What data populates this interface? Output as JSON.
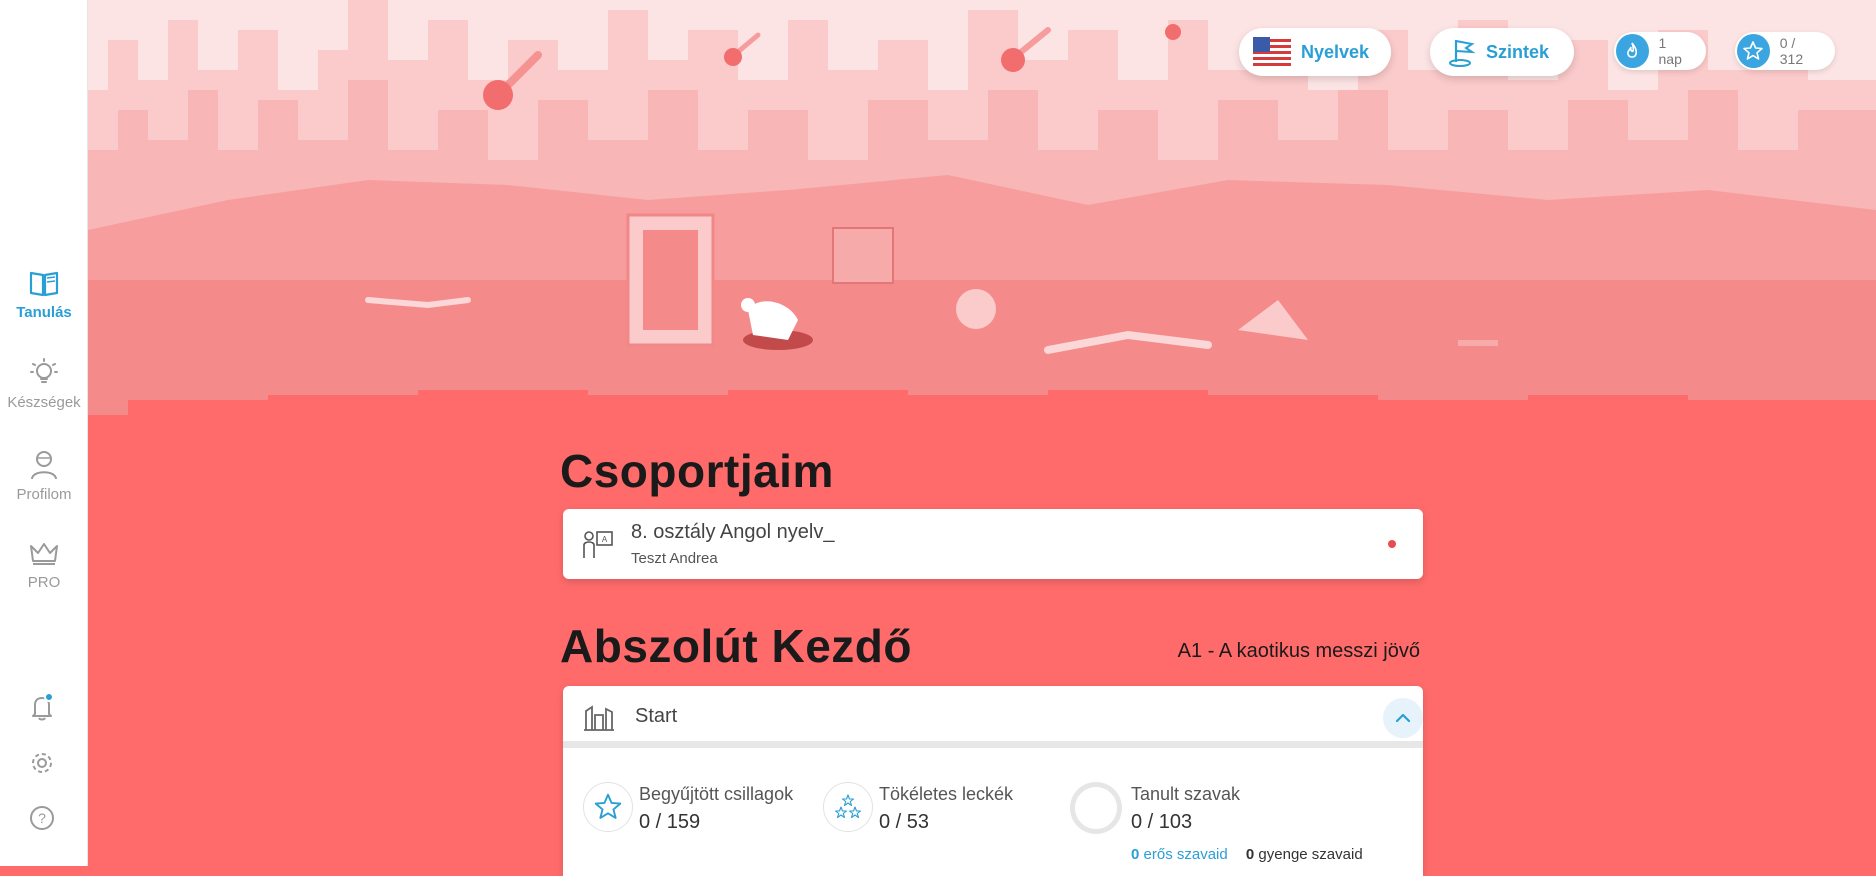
{
  "sidebar": {
    "items": [
      {
        "label": "Tanulás",
        "icon": "book-icon",
        "active": true
      },
      {
        "label": "Készségek",
        "icon": "lightbulb-icon",
        "active": false
      },
      {
        "label": "Profilom",
        "icon": "user-icon",
        "active": false
      },
      {
        "label": "PRO",
        "icon": "crown-icon",
        "active": false
      }
    ],
    "utilities": [
      "bell-icon",
      "gear-icon",
      "help-icon"
    ]
  },
  "topbar": {
    "languages_label": "Nyelvek",
    "levels_label": "Szintek",
    "streak_label": "1 nap",
    "stars_label": "0 / 312"
  },
  "groups": {
    "heading": "Csoportjaim",
    "items": [
      {
        "title": "8. osztály Angol nyelv_",
        "teacher": "Teszt Andrea"
      }
    ]
  },
  "course": {
    "heading": "Abszolút Kezdő",
    "level_title": "A1 - A kaotikus messzi jövő",
    "unit": {
      "title": "Start",
      "stats": {
        "stars_label": "Begyűjtött csillagok",
        "stars_value": "0 / 159",
        "perfect_label": "Tökéletes leckék",
        "perfect_value": "0 / 53",
        "words_label": "Tanult szavak",
        "words_value": "0 / 103",
        "strong_count": "0",
        "strong_label": "erős szavaid",
        "weak_count": "0",
        "weak_label": "gyenge szavaid"
      }
    }
  },
  "colors": {
    "accent": "#2a9fd6",
    "background": "#ff6b6b",
    "hero_sky": "#fde4e4",
    "notification_dot": "#e84c4c"
  }
}
